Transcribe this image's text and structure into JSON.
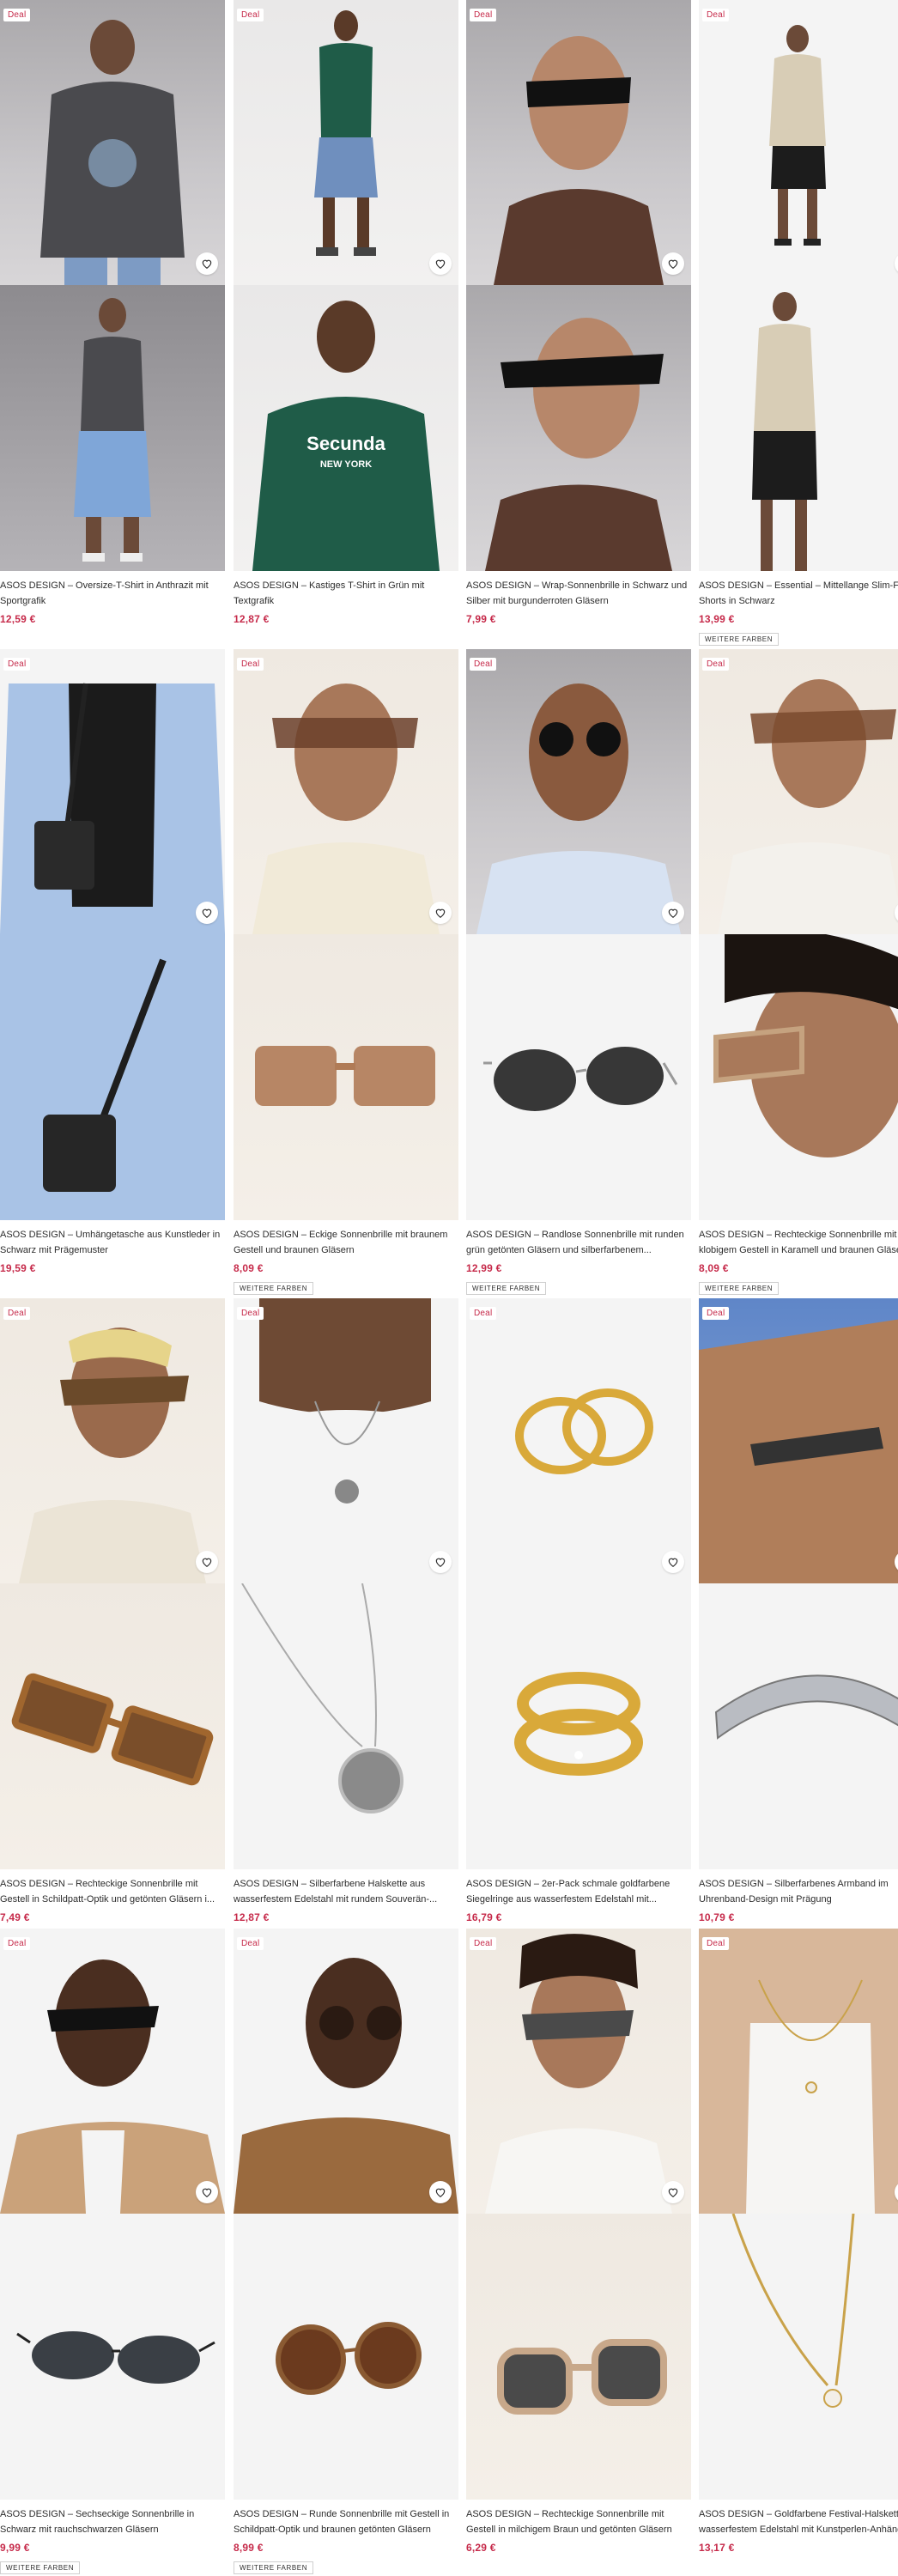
{
  "products": [
    {
      "title": "ASOS DESIGN – Oversize-T-Shirt in Anthrazit mit Sportgrafik",
      "price": "12,59 €",
      "deal": "Deal",
      "more": ""
    },
    {
      "title": "ASOS DESIGN – Kastiges T-Shirt in Grün mit Textgrafik",
      "price": "12,87 €",
      "deal": "Deal",
      "more": "",
      "shirt_text": "Secunda",
      "shirt_sub": "NEW YORK"
    },
    {
      "title": "ASOS DESIGN – Wrap-Sonnenbrille in Schwarz und Silber mit burgunderroten Gläsern",
      "price": "7,99 €",
      "deal": "Deal",
      "more": ""
    },
    {
      "title": "ASOS DESIGN – Essential – Mittellange Slim-Fit-Shorts in Schwarz",
      "price": "13,99 €",
      "deal": "Deal",
      "more": "WEITERE FARBEN"
    },
    {
      "title": "ASOS DESIGN – Umhängetasche aus Kunstleder in Schwarz mit Prägemuster",
      "price": "19,59 €",
      "deal": "Deal",
      "more": ""
    },
    {
      "title": "ASOS DESIGN – Eckige Sonnenbrille mit braunem Gestell und braunen Gläsern",
      "price": "8,09 €",
      "deal": "Deal",
      "more": "WEITERE FARBEN"
    },
    {
      "title": "ASOS DESIGN – Randlose Sonnenbrille mit runden grün getönten Gläsern und silberfarbenem...",
      "price": "12,99 €",
      "deal": "Deal",
      "more": "WEITERE FARBEN"
    },
    {
      "title": "ASOS DESIGN – Rechteckige Sonnenbrille mit klobigem Gestell in Karamell und braunen Gläsern",
      "price": "8,09 €",
      "deal": "Deal",
      "more": "WEITERE FARBEN"
    },
    {
      "title": "ASOS DESIGN – Rechteckige Sonnenbrille mit Gestell in Schildpatt-Optik und getönten Gläsern i...",
      "price": "7,49 €",
      "deal": "Deal",
      "more": ""
    },
    {
      "title": "ASOS DESIGN – Silberfarbene Halskette aus wasserfestem Edelstahl mit rundem Souverän-...",
      "price": "12,87 €",
      "deal": "Deal",
      "more": ""
    },
    {
      "title": "ASOS DESIGN – 2er-Pack schmale goldfarbene Siegelringe aus wasserfestem Edelstahl mit...",
      "price": "16,79 €",
      "deal": "Deal",
      "more": ""
    },
    {
      "title": "ASOS DESIGN – Silberfarbenes Armband im Uhrenband-Design mit Prägung",
      "price": "10,79 €",
      "deal": "Deal",
      "more": ""
    },
    {
      "title": "ASOS DESIGN – Sechseckige Sonnenbrille in Schwarz mit rauchschwarzen Gläsern",
      "price": "9,99 €",
      "deal": "Deal",
      "more": "WEITERE FARBEN"
    },
    {
      "title": "ASOS DESIGN – Runde Sonnenbrille mit Gestell in Schildpatt-Optik und braunen getönten Gläsern",
      "price": "8,99 €",
      "deal": "Deal",
      "more": "WEITERE FARBEN"
    },
    {
      "title": "ASOS DESIGN – Rechteckige Sonnenbrille mit Gestell in milchigem Braun und getönten Gläsern",
      "price": "6,29 €",
      "deal": "Deal",
      "more": ""
    },
    {
      "title": "ASOS DESIGN – Goldfarbene Festival-Halskette aus wasserfestem Edelstahl mit Kunstperlen-Anhänger",
      "price": "13,17 €",
      "deal": "Deal",
      "more": ""
    }
  ],
  "colors": {
    "price": "#c62a4a",
    "deal_text": "#c62a4a",
    "text": "#2d2d2d"
  }
}
